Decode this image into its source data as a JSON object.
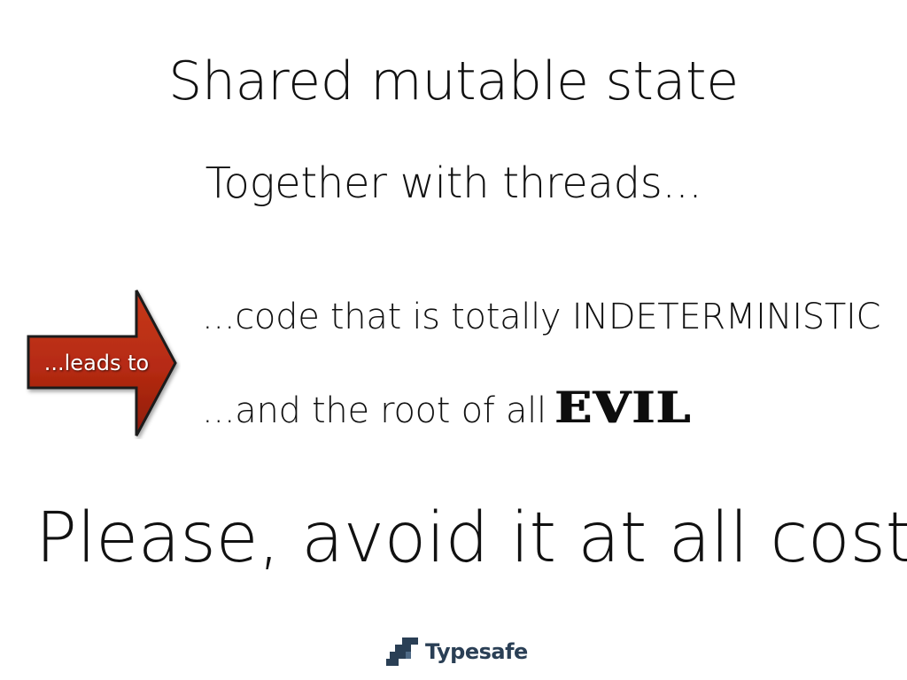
{
  "slide": {
    "title": "Shared mutable state",
    "subtitle": "Together with threads...",
    "arrow_label": "...leads to",
    "bullets": [
      "...code that is totally INDETERMINISTIC",
      "...and the root of all"
    ],
    "emphasis_word": "EVIL",
    "conclusion": "Please, avoid it at all cost"
  },
  "brand": {
    "name": "Typesafe",
    "color": "#2a3f55",
    "icon": "typesafe-logo-icon"
  },
  "colors": {
    "arrow_fill": "#b52a12",
    "arrow_outline": "#1a1a1a",
    "text": "#111111",
    "background": "#ffffff"
  }
}
